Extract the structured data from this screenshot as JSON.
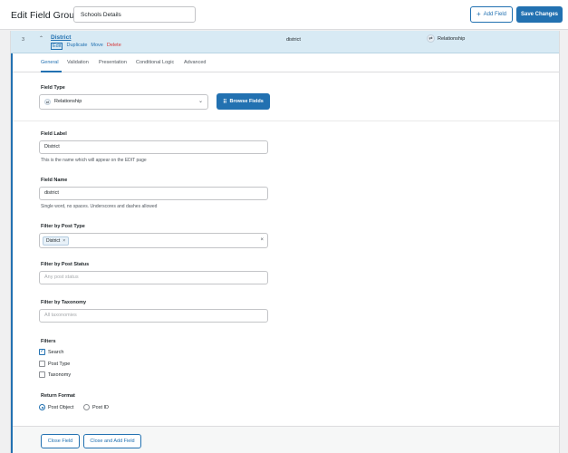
{
  "header": {
    "title": "Edit Field Group",
    "group_name": "Schools Details",
    "add_field_label": "Add Field",
    "save_label": "Save Changes"
  },
  "field_row": {
    "order": "3",
    "label": "District",
    "actions": {
      "edit": "Edit",
      "duplicate": "Duplicate",
      "move": "Move",
      "delete": "Delete"
    },
    "name": "district",
    "type": "Relationship"
  },
  "tabs": [
    "General",
    "Validation",
    "Presentation",
    "Conditional Logic",
    "Advanced"
  ],
  "field_type": {
    "label": "Field Type",
    "value": "Relationship",
    "browse_label": "Browse Fields"
  },
  "field_label": {
    "label": "Field Label",
    "value": "District",
    "hint": "This is the name which will appear on the EDIT page"
  },
  "field_name": {
    "label": "Field Name",
    "value": "district",
    "hint": "Single word, no spaces. Underscores and dashes allowed"
  },
  "post_type_filter": {
    "label": "Filter by Post Type",
    "chip": "District"
  },
  "post_status_filter": {
    "label": "Filter by Post Status",
    "placeholder": "Any post status"
  },
  "taxonomy_filter": {
    "label": "Filter by Taxonomy",
    "placeholder": "All taxonomies"
  },
  "filters": {
    "label": "Filters",
    "options": [
      {
        "label": "Search",
        "checked": true
      },
      {
        "label": "Post Type",
        "checked": false
      },
      {
        "label": "Taxonomy",
        "checked": false
      }
    ]
  },
  "return_format": {
    "label": "Return Format",
    "options": [
      {
        "label": "Post Object",
        "selected": true
      },
      {
        "label": "Post ID",
        "selected": false
      }
    ]
  },
  "footer": {
    "close_label": "Close Field",
    "close_add_label": "Close and Add Field"
  },
  "colors": {
    "primary": "#2271b1",
    "row_bg": "#d8eaf4",
    "danger": "#d63638"
  }
}
